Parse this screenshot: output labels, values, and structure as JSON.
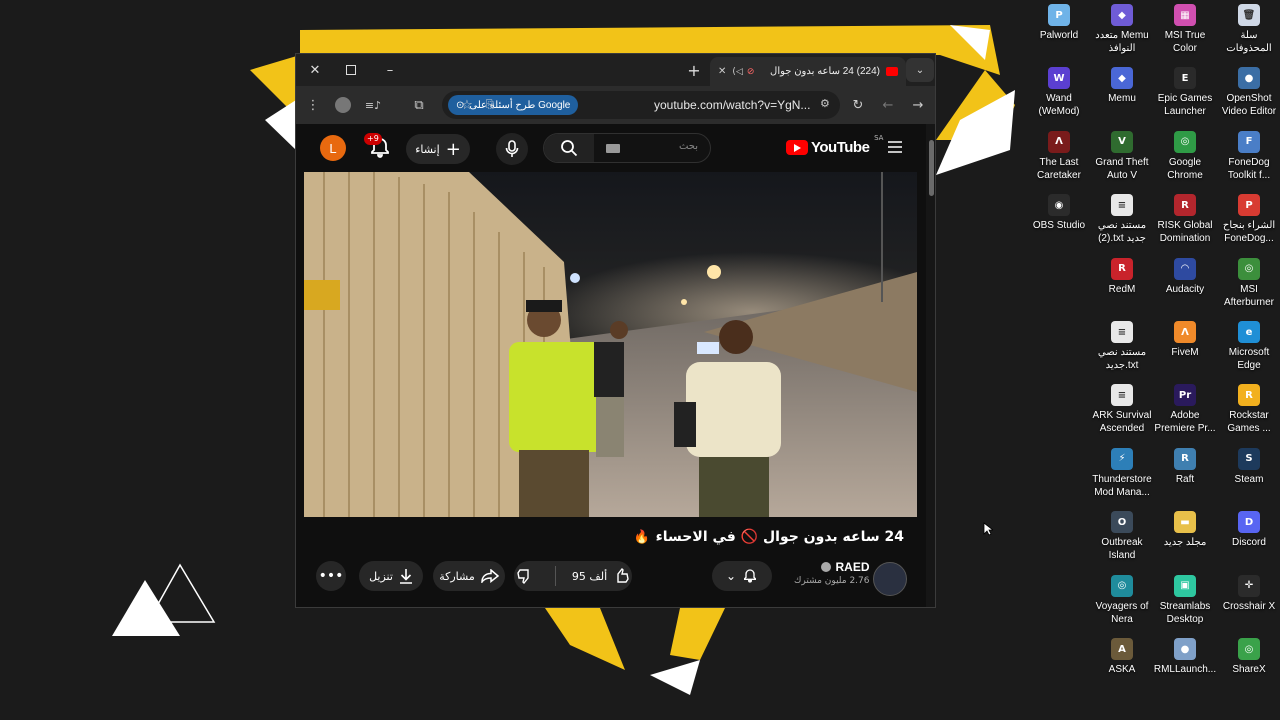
{
  "desktop": {
    "icons": [
      {
        "label": "Palworld",
        "color": "#6fb3e8",
        "glyph": "P"
      },
      {
        "label": "متعدد Memu\nالنوافذ",
        "color": "#6f5cd6",
        "glyph": "◆"
      },
      {
        "label": "MSI True\nColor",
        "color": "#d04fb0",
        "glyph": "▦"
      },
      {
        "label": "سلة\nالمحذوفات",
        "color": "#cfd8e6",
        "glyph": "🗑"
      },
      {
        "label": "Wand\n(WeMod)",
        "color": "#5b3fd1",
        "glyph": "W"
      },
      {
        "label": "Memu",
        "color": "#4a67d6",
        "glyph": "◆"
      },
      {
        "label": "Epic Games\nLauncher",
        "color": "#2a2a2a",
        "glyph": "E"
      },
      {
        "label": "OpenShot\nVideo Editor",
        "color": "#3b6ea5",
        "glyph": "●"
      },
      {
        "label": "The Last\nCaretaker",
        "color": "#7a1b1b",
        "glyph": "Λ"
      },
      {
        "label": "Grand Theft\nAuto V",
        "color": "#2f6b2f",
        "glyph": "V"
      },
      {
        "label": "Google\nChrome",
        "color": "#2f9b46",
        "glyph": "◎"
      },
      {
        "label": "FoneDog\nToolkit f...",
        "color": "#4a7ec7",
        "glyph": "F"
      },
      {
        "label": "OBS Studio",
        "color": "#2b2b2b",
        "glyph": "◉"
      },
      {
        "label": "مستند نصي\n(2).txt جديد",
        "color": "#e8e8e8",
        "glyph": "≡"
      },
      {
        "label": "RISK Global\nDomination",
        "color": "#b3262d",
        "glyph": "R"
      },
      {
        "label": "الشراء بنجاح\nFoneDog...",
        "color": "#d83b32",
        "glyph": "P"
      },
      {
        "label": "RedM",
        "color": "#c9232b",
        "glyph": "R"
      },
      {
        "label": "Audacity",
        "color": "#2e4aa0",
        "glyph": "◠"
      },
      {
        "label": "MSI\nAfterburner",
        "color": "#3c8f3c",
        "glyph": "◎"
      },
      {
        "label": "مستند نصي\nجديد.txt",
        "color": "#e8e8e8",
        "glyph": "≡"
      },
      {
        "label": "FiveM",
        "color": "#f08a2a",
        "glyph": "Λ"
      },
      {
        "label": "Microsoft\nEdge",
        "color": "#1f8fd6",
        "glyph": "e"
      },
      {
        "label": "ARK Survival\nAscended",
        "color": "#e8e8e8",
        "glyph": "≡"
      },
      {
        "label": "Adobe\nPremiere Pr...",
        "color": "#2a1a5c",
        "glyph": "Pr"
      },
      {
        "label": "Rockstar\nGames ...",
        "color": "#f2b01e",
        "glyph": "R"
      },
      {
        "label": "Thunderstore\nMod Mana...",
        "color": "#2d7fb8",
        "glyph": "⚡"
      },
      {
        "label": "Raft",
        "color": "#3f7fb0",
        "glyph": "R"
      },
      {
        "label": "Steam",
        "color": "#1d3a5c",
        "glyph": "S"
      },
      {
        "label": "Outbreak\nIsland",
        "color": "#3b4a5a",
        "glyph": "O"
      },
      {
        "label": "مجلد جديد",
        "color": "#e8c04a",
        "glyph": "▬"
      },
      {
        "label": "Discord",
        "color": "#5865f2",
        "glyph": "D"
      },
      {
        "label": "Voyagers of\nNera",
        "color": "#1f8c9c",
        "glyph": "◎"
      },
      {
        "label": "Streamlabs\nDesktop",
        "color": "#2ec7a0",
        "glyph": "▣"
      },
      {
        "label": "Crosshair X",
        "color": "#2b2b2b",
        "glyph": "✛"
      },
      {
        "label": "ASKA",
        "color": "#6b5a3a",
        "glyph": "A"
      },
      {
        "label": "RMLLaunch...",
        "color": "#7fa0c8",
        "glyph": "●"
      },
      {
        "label": "ShareX",
        "color": "#3aa24a",
        "glyph": "◎"
      }
    ]
  },
  "browser": {
    "tab_title": "(224) 24 ساعه بدون جوال",
    "url": "youtube.com/watch?v=YgN...",
    "google_button": "طرح أسئلة على Google"
  },
  "youtube": {
    "logo": "YouTube",
    "region": "SA",
    "search_placeholder": "بحث",
    "create_label": "إنشاء",
    "notif_badge": "+9",
    "avatar_letter": "L",
    "video_title": "24 ساعه بدون جوال 🚫 في الاحساء",
    "channel_name": "RAED",
    "subscribers": "2.76 مليون مشترك",
    "likes": "95 ألف",
    "share_label": "مشاركة",
    "download_label": "تنزيل"
  }
}
